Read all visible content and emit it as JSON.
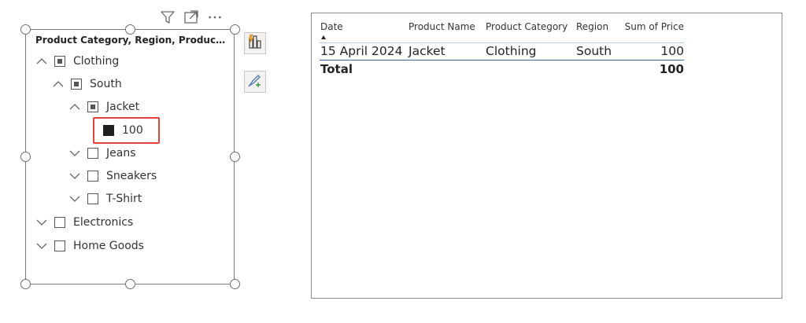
{
  "slicer": {
    "header": "Product Category, Region, Product...",
    "toolbar": {
      "filter_icon": "filter-icon",
      "focus_icon": "focus-mode-icon",
      "more_icon": "more-options-icon"
    },
    "items": [
      {
        "label": "Clothing",
        "expanded": true,
        "state": "partial"
      },
      {
        "label": "South",
        "expanded": true,
        "state": "partial"
      },
      {
        "label": "Jacket",
        "expanded": true,
        "state": "partial"
      },
      {
        "label": "100",
        "state": "selected"
      },
      {
        "label": "Jeans",
        "expanded": false,
        "state": "unchecked"
      },
      {
        "label": "Sneakers",
        "expanded": false,
        "state": "unchecked"
      },
      {
        "label": "T-Shirt",
        "expanded": false,
        "state": "unchecked"
      },
      {
        "label": "Electronics",
        "expanded": false,
        "state": "unchecked"
      },
      {
        "label": "Home Goods",
        "expanded": false,
        "state": "unchecked"
      }
    ],
    "highlight_color": "#e0443c"
  },
  "side_buttons": {
    "build_visual": "build-visual-icon",
    "format_visual": "format-visual-icon"
  },
  "table": {
    "headers": [
      "Date",
      "Product Name",
      "Product Category",
      "Region",
      "Sum of Price"
    ],
    "rows": [
      [
        "15 April 2024",
        "Jacket",
        "Clothing",
        "South",
        "100"
      ]
    ],
    "total": {
      "label": "Total",
      "value": "100"
    },
    "accent_color": "#2e6da4"
  }
}
